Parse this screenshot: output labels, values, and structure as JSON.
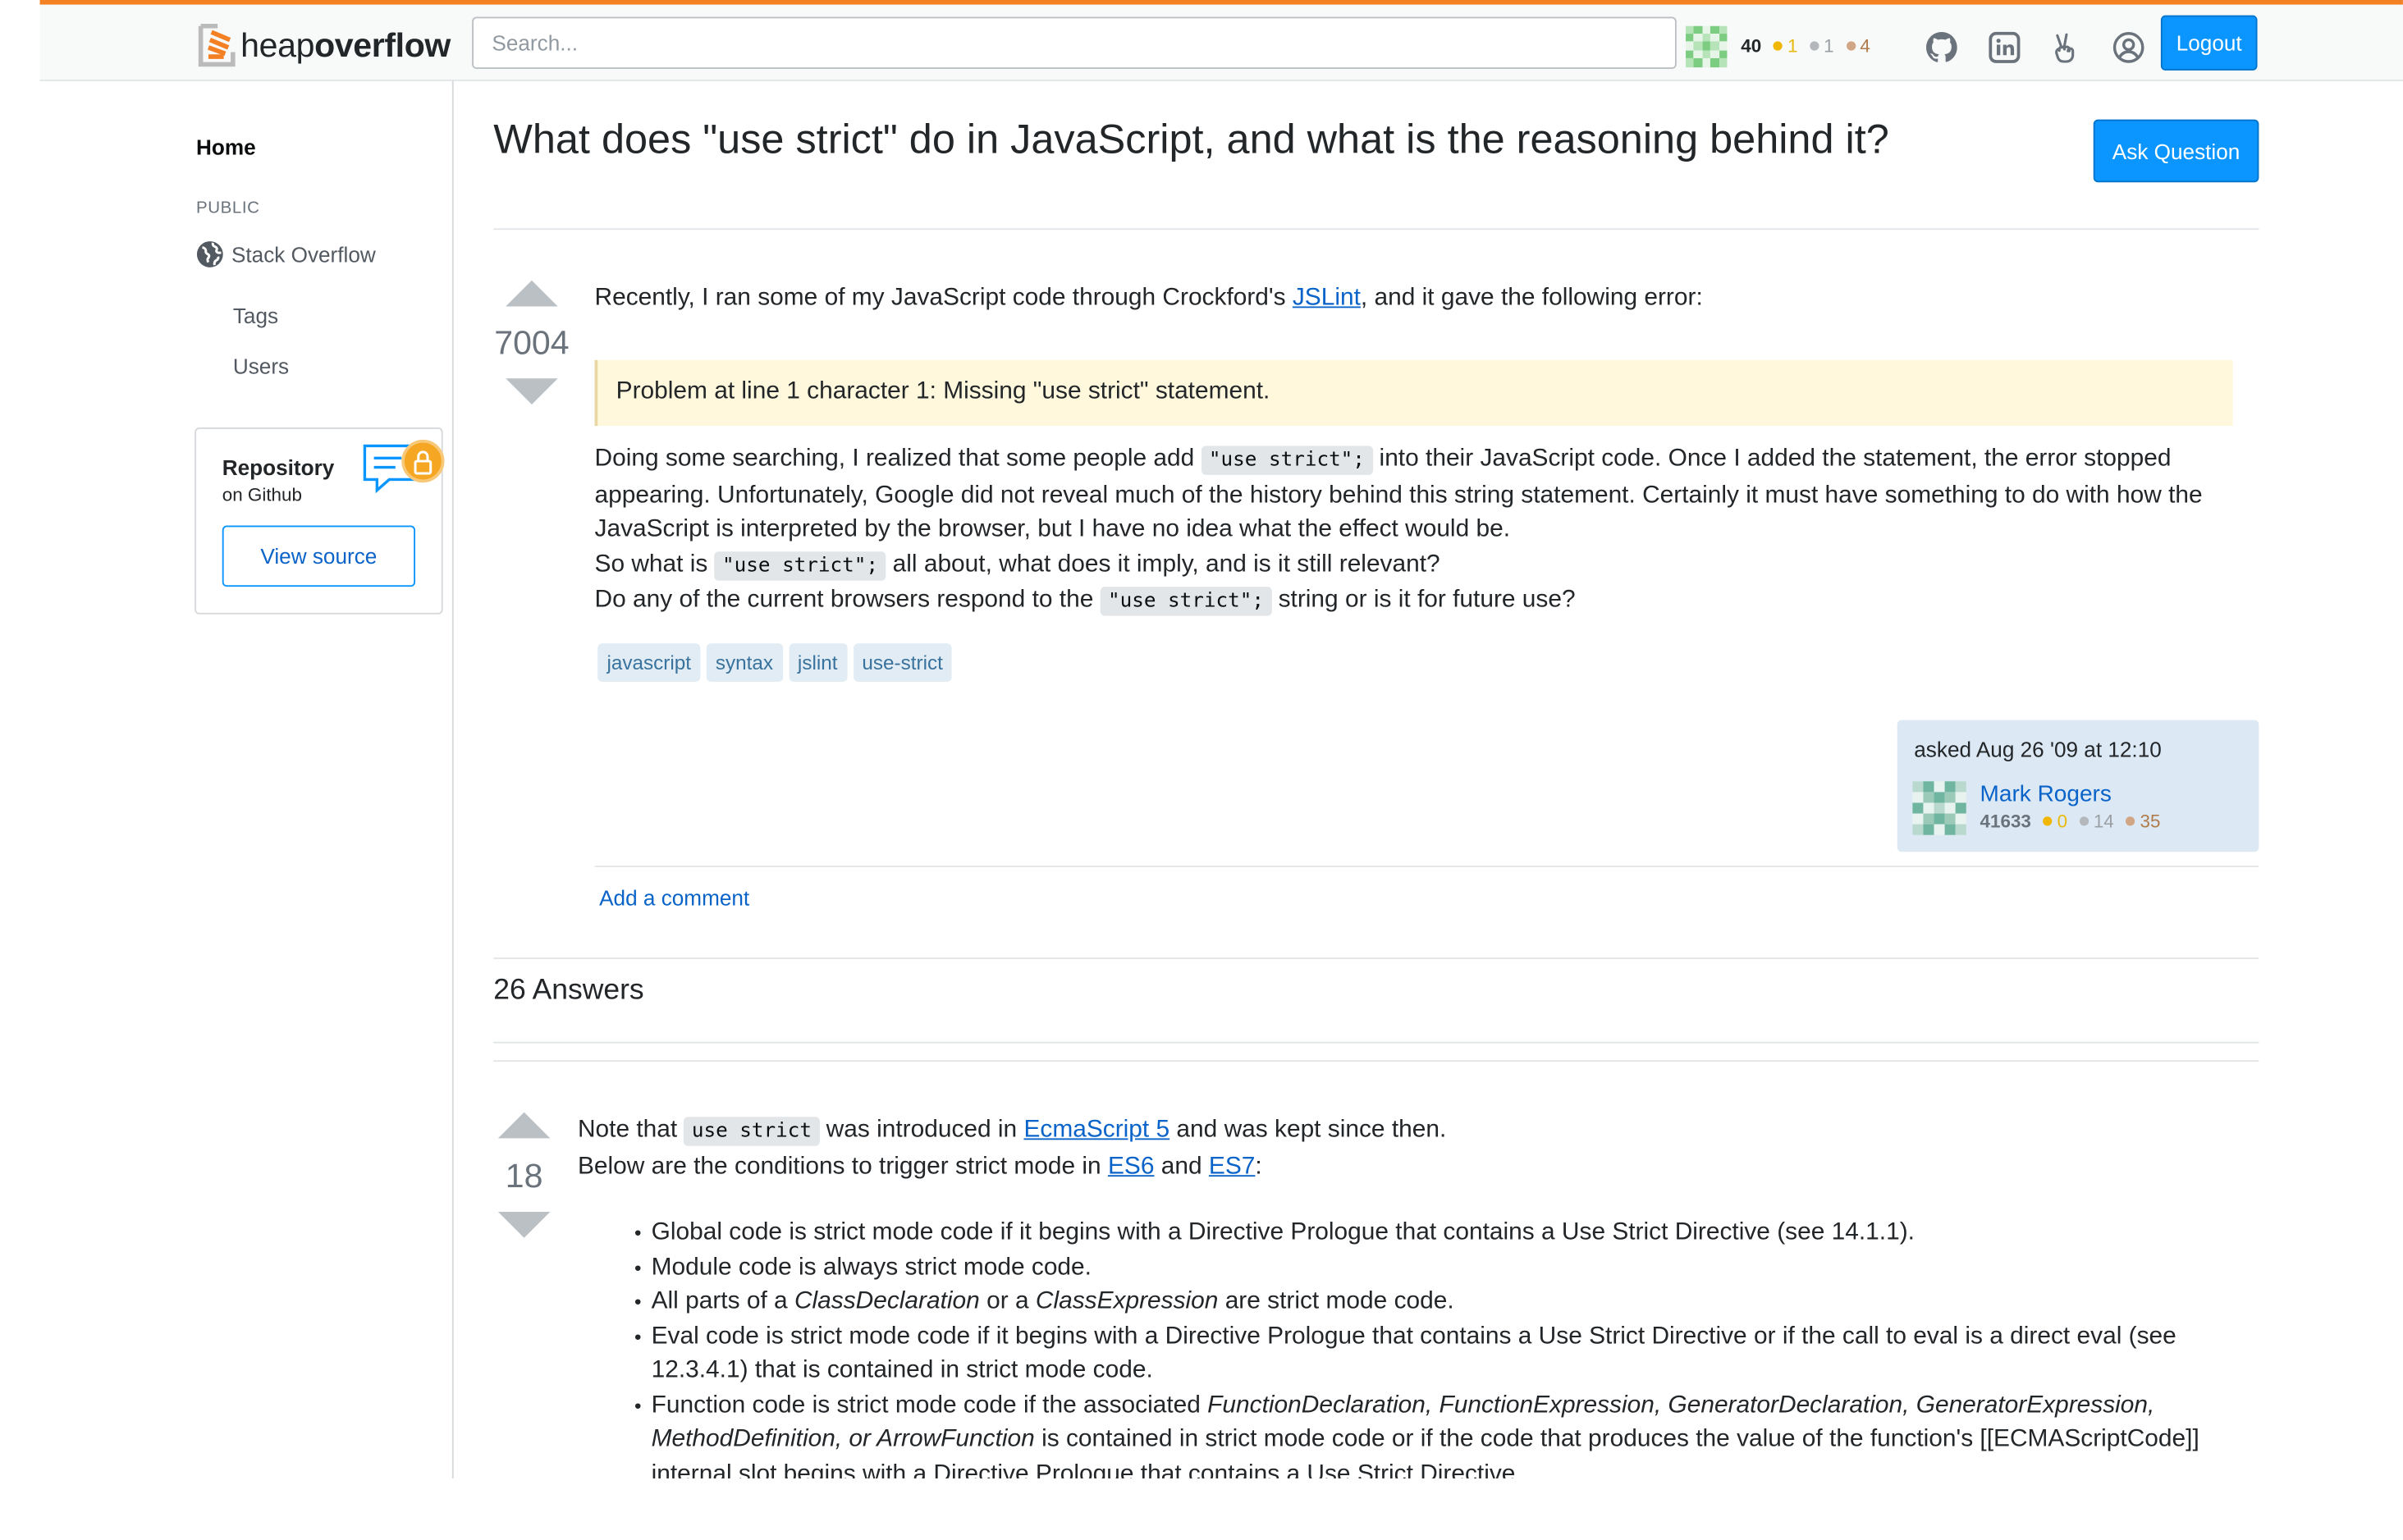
{
  "header": {
    "logo_heap": "heap",
    "logo_overflow": "overflow",
    "search_placeholder": "Search...",
    "user_rep": "40",
    "user_gold": "1",
    "user_silver": "1",
    "user_bronze": "4",
    "logout_label": "Logout",
    "icons": [
      "github-icon",
      "linkedin-icon",
      "hand-peace-icon",
      "user-circle-icon"
    ]
  },
  "sidebar": {
    "home": "Home",
    "public": "PUBLIC",
    "stack_overflow": "Stack Overflow",
    "tags": "Tags",
    "users": "Users",
    "repo_title": "Repository",
    "repo_sub": "on Github",
    "view_source": "View source"
  },
  "question": {
    "title": "What does \"use strict\" do in JavaScript, and what is the reasoning behind it?",
    "ask_button": "Ask Question",
    "votes": "7004",
    "intro_before": "Recently, I ran some of my JavaScript code through Crockford's ",
    "intro_link": "JSLint",
    "intro_after": ", and it gave the following error:",
    "blockquote": "Problem at line 1 character 1: Missing \"use strict\" statement.",
    "p2_a": "Doing some searching, I realized that some people add ",
    "p2_code": "\"use strict\";",
    "p2_b": " into their JavaScript code. Once I added the statement, the error stopped appearing. Unfortunately, Google did not reveal much of the history behind this string statement. Certainly it must have something to do with how the JavaScript is interpreted by the browser, but I have no idea what the effect would be.",
    "p3_a": "So what is ",
    "p3_code": "\"use strict\";",
    "p3_b": " all about, what does it imply, and is it still relevant?",
    "p4_a": "Do any of the current browsers respond to the ",
    "p4_code": "\"use strict\";",
    "p4_b": " string or is it for future use?",
    "tags": [
      "javascript",
      "syntax",
      "jslint",
      "use-strict"
    ],
    "asked": "asked Aug 26 '09 at 12:10",
    "owner_name": "Mark Rogers",
    "owner_rep": "41633",
    "owner_gold": "0",
    "owner_silver": "14",
    "owner_bronze": "35",
    "add_comment": "Add a comment"
  },
  "answers_header": "26 Answers",
  "answer": {
    "votes": "18",
    "l1_a": "Note that ",
    "l1_code": "use strict",
    "l1_b": " was introduced in ",
    "l1_link": "EcmaScript 5",
    "l1_c": " and was kept since then.",
    "l2_a": "Below are the conditions to trigger strict mode in ",
    "l2_link1": "ES6",
    "l2_and": " and ",
    "l2_link2": "ES7",
    "l2_end": ":",
    "b1": "Global code is strict mode code if it begins with a Directive Prologue that contains a Use Strict Directive (see 14.1.1).",
    "b2": "Module code is always strict mode code.",
    "b3_a": "All parts of a ",
    "b3_i1": "ClassDeclaration",
    "b3_b": " or a ",
    "b3_i2": "ClassExpression",
    "b3_c": " are strict mode code.",
    "b4": "Eval code is strict mode code if it begins with a Directive Prologue that contains a Use Strict Directive or if the call to eval is a direct eval (see 12.3.4.1) that is contained in strict mode code.",
    "b5_a": "Function code is strict mode code if the associated ",
    "b5_i": "FunctionDeclaration, FunctionExpression, GeneratorDeclaration, GeneratorExpression, MethodDefinition, or ArrowFunction",
    "b5_b": " is contained in strict mode code or if the code that produces the value of the function's [[ECMAScriptCode]] internal slot begins with a Directive Prologue that contains a Use Strict Directive."
  },
  "colors": {
    "accent_orange": "#f48024",
    "primary_blue": "#0a95ff",
    "link_blue": "#0a63c9",
    "tag_bg": "#e1ecf4",
    "tag_text": "#39739d",
    "quote_bg": "#fff8dc",
    "owner_bg": "#dce9f4"
  }
}
